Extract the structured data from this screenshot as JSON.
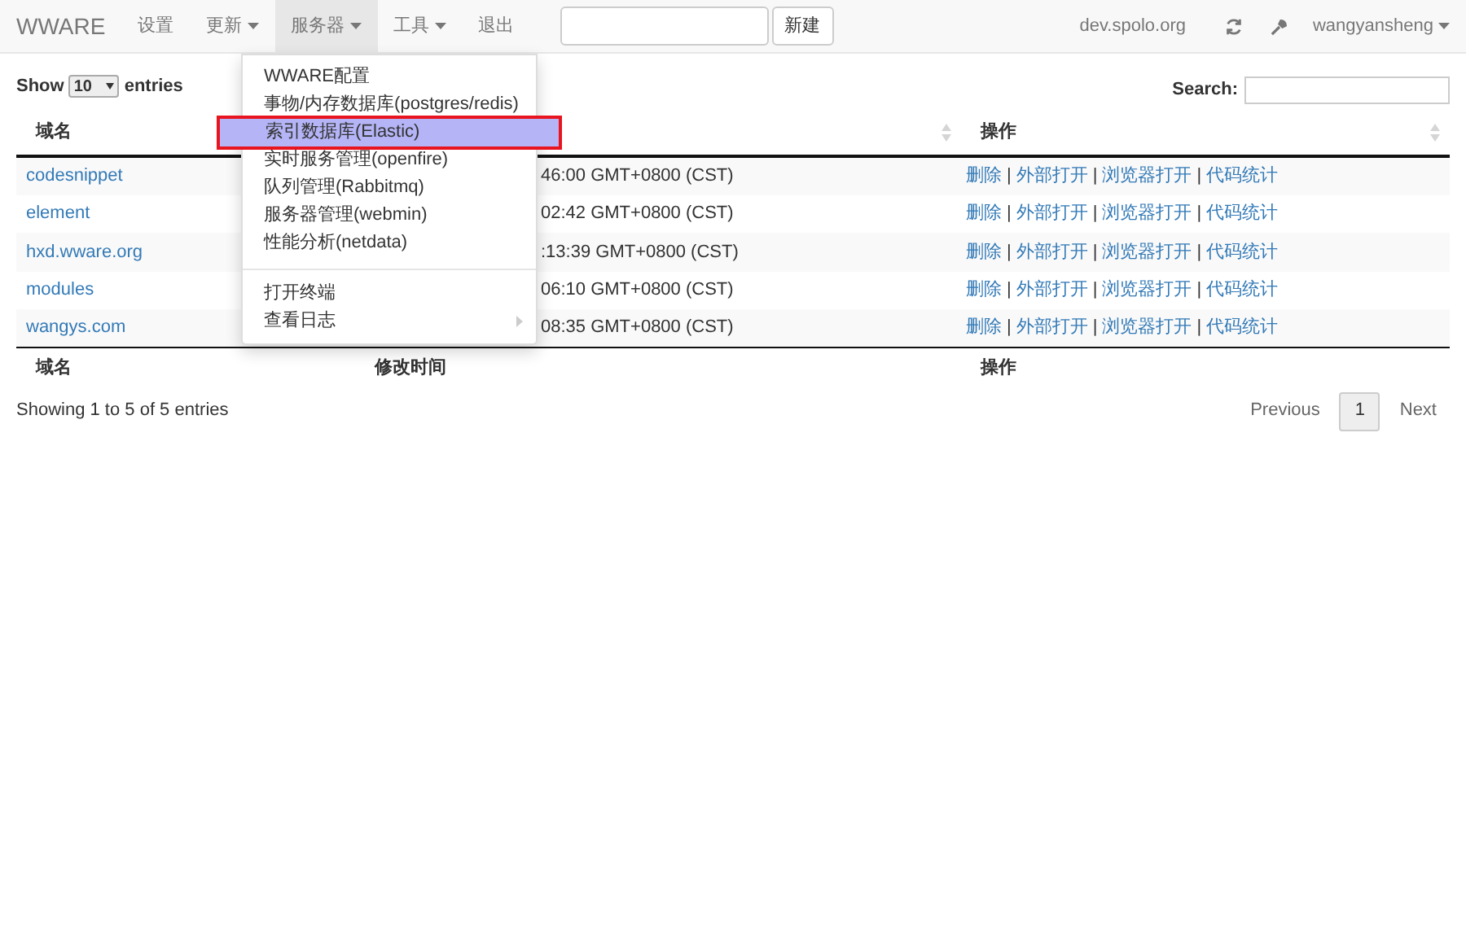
{
  "navbar": {
    "brand": "WWARE",
    "items": [
      {
        "label": "设置",
        "caret": false,
        "selected": false
      },
      {
        "label": "更新",
        "caret": true,
        "selected": false
      },
      {
        "label": "服务器",
        "caret": true,
        "selected": true
      },
      {
        "label": "工具",
        "caret": true,
        "selected": false
      },
      {
        "label": "退出",
        "caret": false,
        "selected": false
      }
    ],
    "new_button": "新建",
    "host": "dev.spolo.org",
    "user": "wangyansheng"
  },
  "length": {
    "show": "Show",
    "value": "10",
    "entries": "entries"
  },
  "search": {
    "label": "Search:"
  },
  "table": {
    "separator": "|",
    "columns": [
      "域名",
      "操作"
    ],
    "rows": [
      {
        "domain": "codesnippet",
        "time": "46:00 GMT+0800 (CST)",
        "actions": [
          "删除",
          "外部打开",
          "浏览器打开",
          "代码统计"
        ]
      },
      {
        "domain": "element",
        "time": "02:42 GMT+0800 (CST)",
        "actions": [
          "删除",
          "外部打开",
          "浏览器打开",
          "代码统计"
        ]
      },
      {
        "domain": "hxd.wware.org",
        "time": ":13:39 GMT+0800 (CST)",
        "actions": [
          "删除",
          "外部打开",
          "浏览器打开",
          "代码统计"
        ]
      },
      {
        "domain": "modules",
        "time": "06:10 GMT+0800 (CST)",
        "actions": [
          "删除",
          "外部打开",
          "浏览器打开",
          "代码统计"
        ]
      },
      {
        "domain": "wangys.com",
        "time": "08:35 GMT+0800 (CST)",
        "actions": [
          "删除",
          "外部打开",
          "浏览器打开",
          "代码统计"
        ]
      }
    ],
    "footer": [
      "域名",
      "修改时间",
      "操作"
    ]
  },
  "info": "Showing 1 to 5 of 5 entries",
  "pagination": {
    "previous": "Previous",
    "page": "1",
    "next": "Next"
  },
  "menu": {
    "groups": [
      [
        {
          "label": "WWARE配置",
          "selected": false,
          "submenu": false
        },
        {
          "label": "事物/内存数据库(postgres/redis)",
          "selected": false,
          "submenu": false
        },
        {
          "label": "索引数据库(Elastic)",
          "selected": true,
          "submenu": false
        },
        {
          "label": "实时服务管理(openfire)",
          "selected": false,
          "submenu": false
        },
        {
          "label": "队列管理(Rabbitmq)",
          "selected": false,
          "submenu": false
        },
        {
          "label": "服务器管理(webmin)",
          "selected": false,
          "submenu": false
        },
        {
          "label": "性能分析(netdata)",
          "selected": false,
          "submenu": false
        }
      ],
      [
        {
          "label": "打开终端",
          "selected": false,
          "submenu": false
        },
        {
          "label": "查看日志",
          "selected": false,
          "submenu": true
        }
      ]
    ]
  }
}
